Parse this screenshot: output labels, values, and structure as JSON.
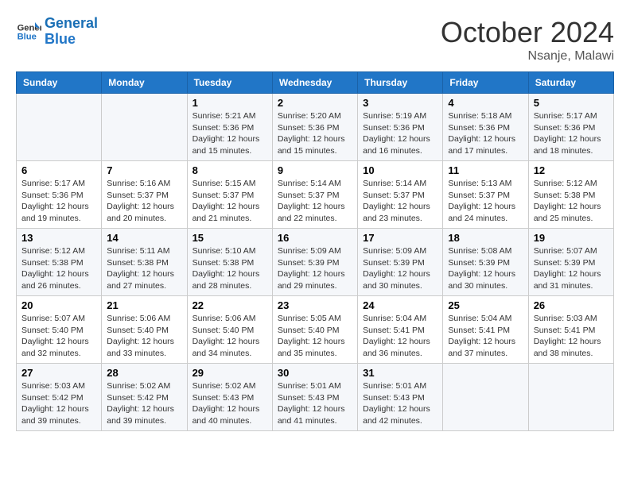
{
  "header": {
    "logo_line1": "General",
    "logo_line2": "Blue",
    "month": "October 2024",
    "location": "Nsanje, Malawi"
  },
  "weekdays": [
    "Sunday",
    "Monday",
    "Tuesday",
    "Wednesday",
    "Thursday",
    "Friday",
    "Saturday"
  ],
  "weeks": [
    [
      {
        "day": "",
        "sunrise": "",
        "sunset": "",
        "daylight": ""
      },
      {
        "day": "",
        "sunrise": "",
        "sunset": "",
        "daylight": ""
      },
      {
        "day": "1",
        "sunrise": "Sunrise: 5:21 AM",
        "sunset": "Sunset: 5:36 PM",
        "daylight": "Daylight: 12 hours and 15 minutes."
      },
      {
        "day": "2",
        "sunrise": "Sunrise: 5:20 AM",
        "sunset": "Sunset: 5:36 PM",
        "daylight": "Daylight: 12 hours and 15 minutes."
      },
      {
        "day": "3",
        "sunrise": "Sunrise: 5:19 AM",
        "sunset": "Sunset: 5:36 PM",
        "daylight": "Daylight: 12 hours and 16 minutes."
      },
      {
        "day": "4",
        "sunrise": "Sunrise: 5:18 AM",
        "sunset": "Sunset: 5:36 PM",
        "daylight": "Daylight: 12 hours and 17 minutes."
      },
      {
        "day": "5",
        "sunrise": "Sunrise: 5:17 AM",
        "sunset": "Sunset: 5:36 PM",
        "daylight": "Daylight: 12 hours and 18 minutes."
      }
    ],
    [
      {
        "day": "6",
        "sunrise": "Sunrise: 5:17 AM",
        "sunset": "Sunset: 5:36 PM",
        "daylight": "Daylight: 12 hours and 19 minutes."
      },
      {
        "day": "7",
        "sunrise": "Sunrise: 5:16 AM",
        "sunset": "Sunset: 5:37 PM",
        "daylight": "Daylight: 12 hours and 20 minutes."
      },
      {
        "day": "8",
        "sunrise": "Sunrise: 5:15 AM",
        "sunset": "Sunset: 5:37 PM",
        "daylight": "Daylight: 12 hours and 21 minutes."
      },
      {
        "day": "9",
        "sunrise": "Sunrise: 5:14 AM",
        "sunset": "Sunset: 5:37 PM",
        "daylight": "Daylight: 12 hours and 22 minutes."
      },
      {
        "day": "10",
        "sunrise": "Sunrise: 5:14 AM",
        "sunset": "Sunset: 5:37 PM",
        "daylight": "Daylight: 12 hours and 23 minutes."
      },
      {
        "day": "11",
        "sunrise": "Sunrise: 5:13 AM",
        "sunset": "Sunset: 5:37 PM",
        "daylight": "Daylight: 12 hours and 24 minutes."
      },
      {
        "day": "12",
        "sunrise": "Sunrise: 5:12 AM",
        "sunset": "Sunset: 5:38 PM",
        "daylight": "Daylight: 12 hours and 25 minutes."
      }
    ],
    [
      {
        "day": "13",
        "sunrise": "Sunrise: 5:12 AM",
        "sunset": "Sunset: 5:38 PM",
        "daylight": "Daylight: 12 hours and 26 minutes."
      },
      {
        "day": "14",
        "sunrise": "Sunrise: 5:11 AM",
        "sunset": "Sunset: 5:38 PM",
        "daylight": "Daylight: 12 hours and 27 minutes."
      },
      {
        "day": "15",
        "sunrise": "Sunrise: 5:10 AM",
        "sunset": "Sunset: 5:38 PM",
        "daylight": "Daylight: 12 hours and 28 minutes."
      },
      {
        "day": "16",
        "sunrise": "Sunrise: 5:09 AM",
        "sunset": "Sunset: 5:39 PM",
        "daylight": "Daylight: 12 hours and 29 minutes."
      },
      {
        "day": "17",
        "sunrise": "Sunrise: 5:09 AM",
        "sunset": "Sunset: 5:39 PM",
        "daylight": "Daylight: 12 hours and 30 minutes."
      },
      {
        "day": "18",
        "sunrise": "Sunrise: 5:08 AM",
        "sunset": "Sunset: 5:39 PM",
        "daylight": "Daylight: 12 hours and 30 minutes."
      },
      {
        "day": "19",
        "sunrise": "Sunrise: 5:07 AM",
        "sunset": "Sunset: 5:39 PM",
        "daylight": "Daylight: 12 hours and 31 minutes."
      }
    ],
    [
      {
        "day": "20",
        "sunrise": "Sunrise: 5:07 AM",
        "sunset": "Sunset: 5:40 PM",
        "daylight": "Daylight: 12 hours and 32 minutes."
      },
      {
        "day": "21",
        "sunrise": "Sunrise: 5:06 AM",
        "sunset": "Sunset: 5:40 PM",
        "daylight": "Daylight: 12 hours and 33 minutes."
      },
      {
        "day": "22",
        "sunrise": "Sunrise: 5:06 AM",
        "sunset": "Sunset: 5:40 PM",
        "daylight": "Daylight: 12 hours and 34 minutes."
      },
      {
        "day": "23",
        "sunrise": "Sunrise: 5:05 AM",
        "sunset": "Sunset: 5:40 PM",
        "daylight": "Daylight: 12 hours and 35 minutes."
      },
      {
        "day": "24",
        "sunrise": "Sunrise: 5:04 AM",
        "sunset": "Sunset: 5:41 PM",
        "daylight": "Daylight: 12 hours and 36 minutes."
      },
      {
        "day": "25",
        "sunrise": "Sunrise: 5:04 AM",
        "sunset": "Sunset: 5:41 PM",
        "daylight": "Daylight: 12 hours and 37 minutes."
      },
      {
        "day": "26",
        "sunrise": "Sunrise: 5:03 AM",
        "sunset": "Sunset: 5:41 PM",
        "daylight": "Daylight: 12 hours and 38 minutes."
      }
    ],
    [
      {
        "day": "27",
        "sunrise": "Sunrise: 5:03 AM",
        "sunset": "Sunset: 5:42 PM",
        "daylight": "Daylight: 12 hours and 39 minutes."
      },
      {
        "day": "28",
        "sunrise": "Sunrise: 5:02 AM",
        "sunset": "Sunset: 5:42 PM",
        "daylight": "Daylight: 12 hours and 39 minutes."
      },
      {
        "day": "29",
        "sunrise": "Sunrise: 5:02 AM",
        "sunset": "Sunset: 5:43 PM",
        "daylight": "Daylight: 12 hours and 40 minutes."
      },
      {
        "day": "30",
        "sunrise": "Sunrise: 5:01 AM",
        "sunset": "Sunset: 5:43 PM",
        "daylight": "Daylight: 12 hours and 41 minutes."
      },
      {
        "day": "31",
        "sunrise": "Sunrise: 5:01 AM",
        "sunset": "Sunset: 5:43 PM",
        "daylight": "Daylight: 12 hours and 42 minutes."
      },
      {
        "day": "",
        "sunrise": "",
        "sunset": "",
        "daylight": ""
      },
      {
        "day": "",
        "sunrise": "",
        "sunset": "",
        "daylight": ""
      }
    ]
  ]
}
